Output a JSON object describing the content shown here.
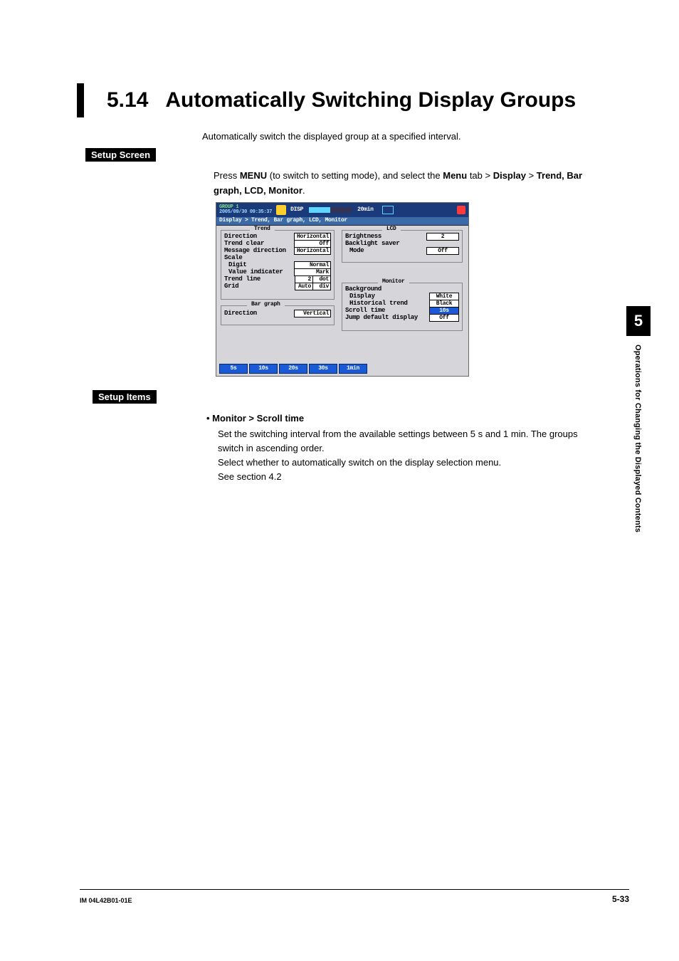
{
  "side_tab": {
    "num": "5",
    "text": "Operations for Changing the Displayed Contents"
  },
  "heading": {
    "num": "5.14",
    "title": "Automatically Switching Display Groups"
  },
  "intro": "Automatically switch the displayed group at a specified interval.",
  "setup_screen": {
    "label": "Setup Screen",
    "instr_pre": "Press ",
    "instr_menu": "MENU",
    "instr_mid1": " (to switch to setting mode), and select the ",
    "instr_menu_tab": "Menu",
    "instr_mid2": " tab > ",
    "instr_display": "Display",
    "instr_mid3": " > ",
    "instr_trend": "Trend, Bar graph, LCD, Monitor",
    "instr_end": "."
  },
  "device_screen": {
    "group": "GROUP 1",
    "timestamp": "2005/09/30 09:35:37",
    "disp": "DISP",
    "interval_badge": "20min",
    "breadcrumb": "Display > Trend, Bar graph, LCD, Monitor",
    "trend": {
      "title": "Trend",
      "rows": {
        "direction_label": "Direction",
        "direction_val": "Horizontal",
        "trend_clear_label": "Trend clear",
        "trend_clear_val": "Off",
        "msg_dir_label": "Message direction",
        "msg_dir_val": "Horizontal",
        "scale_label": "Scale",
        "digit_label": "Digit",
        "digit_val": "Normal",
        "value_ind_label": "Value indicater",
        "value_ind_val": "Mark",
        "trend_line_label": "Trend line",
        "trend_line_val1": "2",
        "trend_line_val2": "dot",
        "grid_label": "Grid",
        "grid_val1": "Auto",
        "grid_val2": "div"
      }
    },
    "bargraph": {
      "title": "Bar graph",
      "direction_label": "Direction",
      "direction_val": "Vertical"
    },
    "lcd": {
      "title": "LCD",
      "brightness_label": "Brightness",
      "brightness_val": "2",
      "backlight_label": "Backlight saver",
      "mode_label": "Mode",
      "mode_val": "Off"
    },
    "monitor": {
      "title": "Monitor",
      "background_label": "Background",
      "display_label": "Display",
      "display_val": "White",
      "hist_trend_label": "Historical trend",
      "hist_trend_val": "Black",
      "scroll_time_label": "Scroll time",
      "scroll_time_val": "10s",
      "jump_label": "Jump default display",
      "jump_val": "Off"
    },
    "softkeys": [
      "5s",
      "10s",
      "20s",
      "30s",
      "1min"
    ]
  },
  "setup_items": {
    "label": "Setup Items",
    "bullet_title": "•  Monitor > Scroll time",
    "body_line1": "Set the switching interval from the available settings between 5 s and 1 min. The groups switch in ascending order.",
    "body_line2": "Select whether to automatically switch on the display selection menu.",
    "body_line3": "See section 4.2"
  },
  "footer": {
    "left": "IM 04L42B01-01E",
    "right": "5-33"
  }
}
